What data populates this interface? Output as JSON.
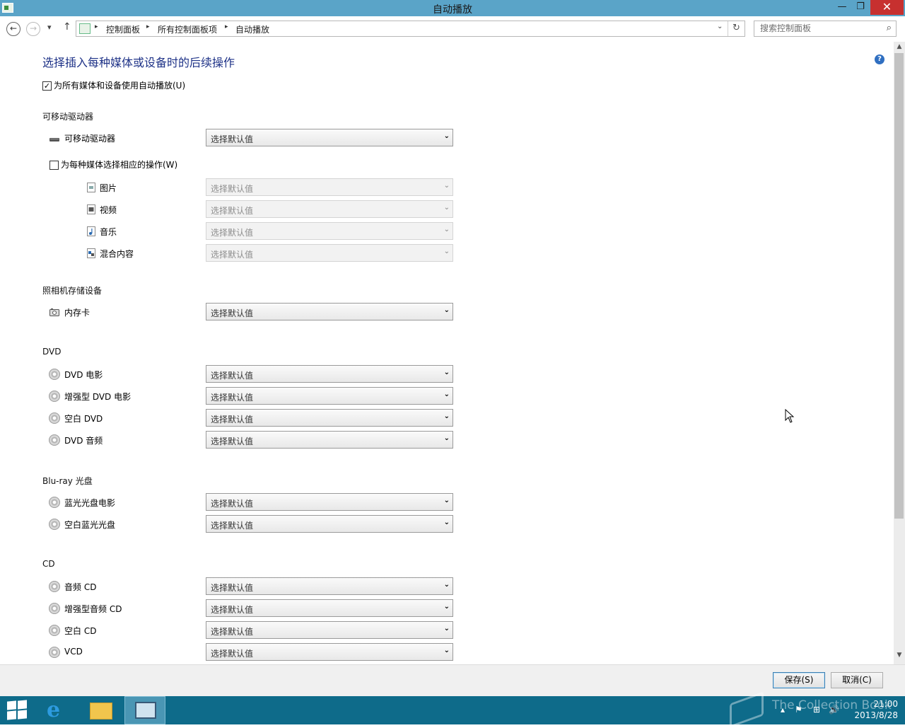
{
  "window": {
    "title": "自动播放",
    "minimize_glyph": "—",
    "maximize_glyph": "❐",
    "close_glyph": "✕"
  },
  "nav": {
    "back_glyph": "←",
    "forward_glyph": "→",
    "recent_glyph": "▾",
    "up_glyph": "↑",
    "breadcrumbs": [
      "控制面板",
      "所有控制面板项",
      "自动播放"
    ],
    "separator": "▸",
    "dropdown_glyph": "⌄",
    "refresh_glyph": "↻",
    "search_placeholder": "搜索控制面板",
    "search_glyph": "⌕"
  },
  "main": {
    "heading": "选择插入每种媒体或设备时的后续操作",
    "help_glyph": "?",
    "autoplay_checkbox": {
      "label": "为所有媒体和设备使用自动播放(U)",
      "checked": true,
      "mark": "✓"
    },
    "select_default": "选择默认值",
    "select_arrow": "⌄",
    "sections": {
      "removable": {
        "title": "可移动驱动器",
        "items": [
          {
            "label": "可移动驱动器",
            "icon": "removable-drive-icon"
          }
        ],
        "per_media_checkbox": {
          "label": "为每种媒体选择相应的操作(W)",
          "checked": false
        },
        "sub_items": [
          {
            "label": "图片",
            "icon": "picture-icon"
          },
          {
            "label": "视频",
            "icon": "video-icon"
          },
          {
            "label": "音乐",
            "icon": "music-icon"
          },
          {
            "label": "混合内容",
            "icon": "mixed-content-icon"
          }
        ]
      },
      "camera": {
        "title": "照相机存储设备",
        "items": [
          {
            "label": "内存卡",
            "icon": "camera-icon"
          }
        ]
      },
      "dvd": {
        "title": "DVD",
        "items": [
          {
            "label": "DVD 电影",
            "icon": "dvd-movie-icon"
          },
          {
            "label": "增强型 DVD 电影",
            "icon": "enhanced-dvd-icon"
          },
          {
            "label": "空白 DVD",
            "icon": "blank-dvd-icon"
          },
          {
            "label": "DVD 音频",
            "icon": "dvd-audio-icon"
          }
        ]
      },
      "bluray": {
        "title": "Blu-ray 光盘",
        "items": [
          {
            "label": "蓝光光盘电影",
            "icon": "bluray-movie-icon"
          },
          {
            "label": "空白蓝光光盘",
            "icon": "blank-bluray-icon"
          }
        ]
      },
      "cd": {
        "title": "CD",
        "items": [
          {
            "label": "音频 CD",
            "icon": "audio-cd-icon"
          },
          {
            "label": "增强型音频 CD",
            "icon": "enhanced-audio-cd-icon"
          },
          {
            "label": "空白 CD",
            "icon": "blank-cd-icon"
          },
          {
            "label": "VCD",
            "icon": "vcd-icon"
          }
        ]
      }
    }
  },
  "scrollbar": {
    "up_glyph": "▲",
    "down_glyph": "▼"
  },
  "footer": {
    "save_label": "保存(S)",
    "cancel_label": "取消(C)"
  },
  "taskbar": {
    "ie_glyph": "e",
    "clock_time": "21:00",
    "clock_date": "2013/8/28",
    "watermark": "The Collection Book",
    "tray_glyphs": [
      "▴",
      "⚑",
      "⊞",
      "🔊"
    ]
  },
  "colors": {
    "titlebar": "#5aa4c8",
    "heading": "#1e3287",
    "taskbar": "#0e6b8a",
    "close_button": "#c7302f"
  }
}
